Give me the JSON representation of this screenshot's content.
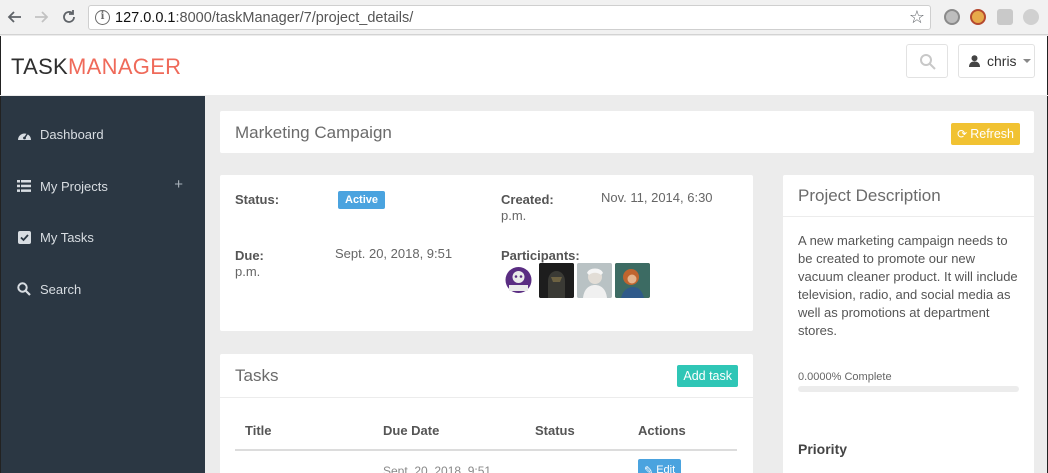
{
  "browser": {
    "url_host": "127.0.0.1",
    "url_rest": ":8000/taskManager/7/project_details/"
  },
  "header": {
    "brand_part1": "TASK",
    "brand_part2": "MANAGER",
    "user_name": "chris"
  },
  "sidebar": {
    "items": [
      {
        "label": "Dashboard",
        "icon": "dashboard-icon"
      },
      {
        "label": "My Projects",
        "icon": "list-icon"
      },
      {
        "label": "My Tasks",
        "icon": "checkbox-icon"
      },
      {
        "label": "Search",
        "icon": "search-icon"
      }
    ]
  },
  "project": {
    "title": "Marketing Campaign",
    "refresh_label": "Refresh",
    "status_label": "Status:",
    "status_value": "Active",
    "created_label": "Created:",
    "created_value_line1": "Nov. 11, 2014, 6:30",
    "created_value_line2": "p.m.",
    "due_label": "Due:",
    "due_label_line2": "p.m.",
    "due_value": "Sept. 20, 2018, 9:51",
    "participants_label": "Participants:",
    "participants": [
      {
        "name": "participant-1",
        "color": "#7a3fa0"
      },
      {
        "name": "participant-2",
        "color": "#2b2b2b"
      },
      {
        "name": "participant-3",
        "color": "#c8ccc8"
      },
      {
        "name": "participant-4",
        "color": "#c0703a"
      }
    ]
  },
  "tasks": {
    "title": "Tasks",
    "add_label": "Add task",
    "columns": [
      "Title",
      "Due Date",
      "Status",
      "Actions"
    ],
    "partial_row_date": "Sept. 20, 2018, 9:51",
    "partial_row_edit": "Edit"
  },
  "description": {
    "title": "Project Description",
    "text": "A new marketing campaign needs to be created to promote our new vacuum cleaner product. It will include television, radio, and social media as well as promotions at department stores.",
    "progress_label": "0.0000% Complete",
    "progress_percent": 0,
    "priority_title": "Priority"
  },
  "colors": {
    "accent": "#ef6a5a",
    "sidebar_bg": "#2b3743",
    "refresh": "#f1c232",
    "add_task": "#2fc6b6",
    "badge": "#4aa3df"
  }
}
